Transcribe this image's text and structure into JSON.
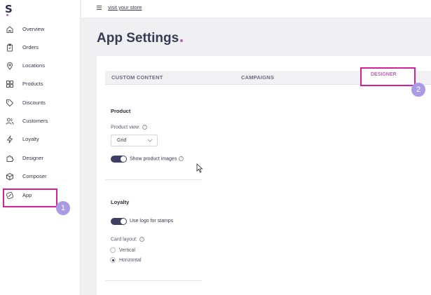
{
  "brand": {
    "logo_letter": "S",
    "accent": "#c957c8",
    "annotation_color": "#d4219a",
    "badge_color": "#a99be6"
  },
  "sidebar": {
    "items": [
      {
        "label": "Overview",
        "icon": "home-icon"
      },
      {
        "label": "Orders",
        "icon": "clipboard-icon"
      },
      {
        "label": "Locations",
        "icon": "map-pin-icon"
      },
      {
        "label": "Products",
        "icon": "grid-icon"
      },
      {
        "label": "Discounts",
        "icon": "tag-icon"
      },
      {
        "label": "Customers",
        "icon": "users-icon"
      },
      {
        "label": "Loyalty",
        "icon": "lightning-icon"
      },
      {
        "label": "Designer",
        "icon": "puzzle-icon"
      },
      {
        "label": "Composer",
        "icon": "box-icon"
      },
      {
        "label": "App",
        "icon": "app-icon"
      }
    ]
  },
  "topbar": {
    "menu_icon": "hamburger-icon",
    "store_link": "visit your store"
  },
  "page": {
    "title": "App Settings"
  },
  "tabs": [
    {
      "label": "CUSTOM CONTENT"
    },
    {
      "label": "CAMPAIGNS"
    },
    {
      "label": "DESIGNER",
      "active": true
    }
  ],
  "product": {
    "section_title": "Product",
    "view_label": "Product view:",
    "view_value": "Grid",
    "show_images_label": "Show product images",
    "show_images_on": true
  },
  "loyalty": {
    "section_title": "Loyalty",
    "logo_stamps_label": "Use logo for stamps",
    "logo_stamps_on": true,
    "card_layout_label": "Card layout:",
    "options": [
      {
        "label": "Vertical",
        "selected": false
      },
      {
        "label": "Horizontal",
        "selected": true
      }
    ]
  },
  "annotations": {
    "step1": "1",
    "step2": "2"
  },
  "help_glyph": "?"
}
